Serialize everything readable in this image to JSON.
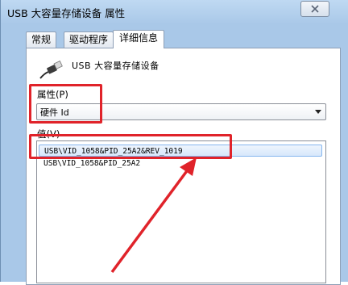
{
  "window": {
    "title": "USB 大容量存储设备 属性",
    "close_symbol": "×"
  },
  "tabs": [
    {
      "label": "常规",
      "active": false
    },
    {
      "label": "驱动程序",
      "active": false
    },
    {
      "label": "详细信息",
      "active": true
    }
  ],
  "device": {
    "icon": "usb-device-icon",
    "name": "USB 大容量存储设备"
  },
  "property": {
    "label": "属性(P)",
    "selected_value": "硬件 Id"
  },
  "value": {
    "label": "值(V)",
    "items": [
      {
        "text": "USB\\VID_1058&PID_25A2&REV_1019",
        "selected": true
      },
      {
        "text": "USB\\VID_1058&PID_25A2",
        "selected": false
      }
    ]
  },
  "colors": {
    "annotation": "#e0232a",
    "selection": "#d7e8fb",
    "frame": "#a9c8e8"
  }
}
